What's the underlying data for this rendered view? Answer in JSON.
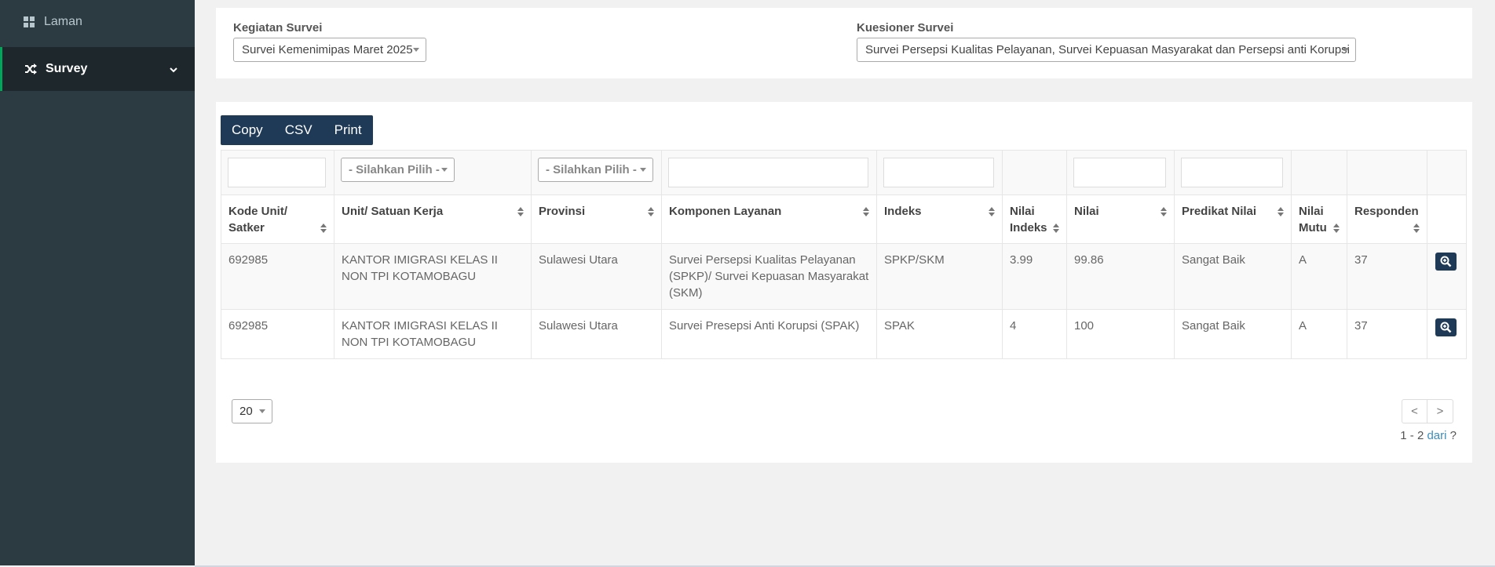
{
  "sidebar": {
    "items": [
      {
        "label": "Laman",
        "icon": "dashboard-icon"
      },
      {
        "label": "Survey",
        "icon": "random-icon"
      }
    ]
  },
  "filters": {
    "kegiatan_label": "Kegiatan Survei",
    "kegiatan_value": "Survei Kemenimipas Maret 2025",
    "kuesioner_label": "Kuesioner Survei",
    "kuesioner_value": "Survei Persepsi Kualitas Pelayanan, Survei Kepuasan Masyarakat dan Persepsi anti Korupsi"
  },
  "toolbar": {
    "copy": "Copy",
    "csv": "CSV",
    "print": "Print"
  },
  "table": {
    "filter_placeholder": "- Silahkan Pilih -",
    "headers": [
      "Kode Unit/ Satker",
      "Unit/ Satuan Kerja",
      "Provinsi",
      "Komponen Layanan",
      "Indeks",
      "Nilai Indeks",
      "Nilai",
      "Predikat Nilai",
      "Nilai Mutu",
      "Responden"
    ],
    "rows": [
      {
        "kode": "692985",
        "unit": "KANTOR IMIGRASI KELAS II NON TPI KOTAMOBAGU",
        "provinsi": "Sulawesi Utara",
        "komponen": "Survei Persepsi Kualitas Pelayanan (SPKP)/ Survei Kepuasan Masyarakat (SKM)",
        "indeks": "SPKP/SKM",
        "nilai_indeks": "3.99",
        "nilai": "99.86",
        "predikat": "Sangat Baik",
        "mutu": "A",
        "responden": "37"
      },
      {
        "kode": "692985",
        "unit": "KANTOR IMIGRASI KELAS II NON TPI KOTAMOBAGU",
        "provinsi": "Sulawesi Utara",
        "komponen": "Survei Presepsi Anti Korupsi (SPAK)",
        "indeks": "SPAK",
        "nilai_indeks": "4",
        "nilai": "100",
        "predikat": "Sangat Baik",
        "mutu": "A",
        "responden": "37"
      }
    ]
  },
  "pagination": {
    "per_page": "20",
    "prev": "<",
    "next": ">",
    "range": "1 - 2",
    "of": "dari",
    "total": "?"
  }
}
